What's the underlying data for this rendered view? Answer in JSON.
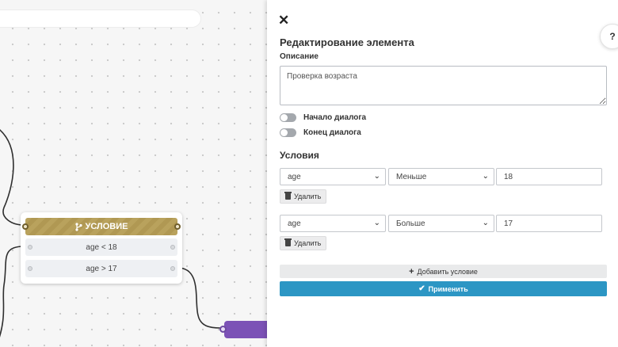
{
  "canvas": {
    "node": {
      "header_icon": "branch-icon",
      "title": "УСЛОВИЕ",
      "rows": [
        "age < 18",
        "age > 17"
      ]
    }
  },
  "panel": {
    "close_icon": "✕",
    "help_label": "?",
    "title": "Редактирование элемента",
    "description_label": "Описание",
    "description_value": "Проверка возраста",
    "toggles": {
      "start_label": "Начало диалога",
      "end_label": "Конец диалога"
    },
    "conditions_title": "Условия",
    "conditions": [
      {
        "field": "age",
        "operator": "Меньше",
        "value": "18"
      },
      {
        "field": "age",
        "operator": "Больше",
        "value": "17"
      }
    ],
    "delete_label": "Удалить",
    "add_condition_label": "Добавить условие",
    "apply_label": "Применить"
  },
  "colors": {
    "condition_header": "#b5a05a",
    "apply_button": "#2c96c4",
    "purple_node": "#7c52b6"
  }
}
